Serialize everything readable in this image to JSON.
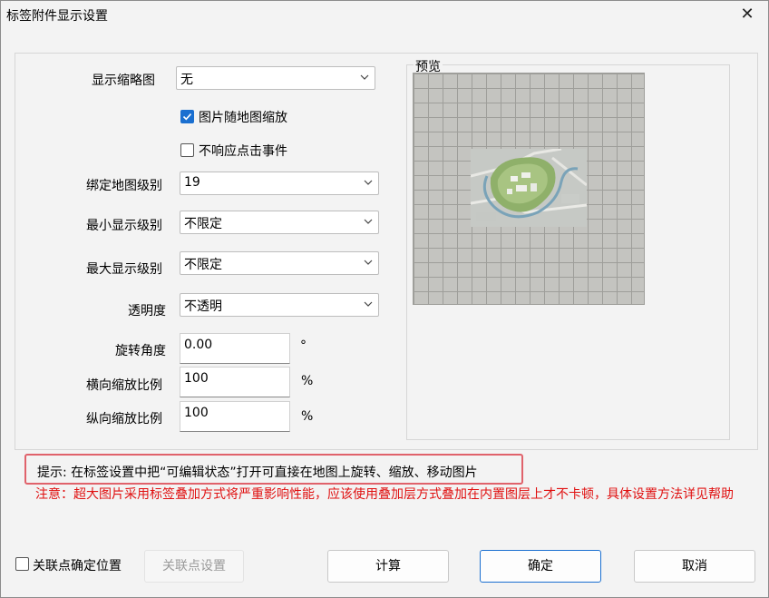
{
  "window": {
    "title": "标签附件显示设置",
    "close_glyph": "✕"
  },
  "form": {
    "thumbnail_label": "显示缩略图",
    "thumbnail_value": "无",
    "scale_with_map_label": "图片随地图缩放",
    "scale_with_map_checked": true,
    "ignore_click_label": "不响应点击事件",
    "ignore_click_checked": false,
    "bind_level_label": "绑定地图级别",
    "bind_level_value": "19",
    "min_level_label": "最小显示级别",
    "min_level_value": "不限定",
    "max_level_label": "最大显示级别",
    "max_level_value": "不限定",
    "opacity_label": "透明度",
    "opacity_value": "不透明",
    "rotation_label": "旋转角度",
    "rotation_value": "0.00",
    "rotation_unit": "°",
    "hscale_label": "横向缩放比例",
    "hscale_value": "100",
    "hscale_unit": "%",
    "vscale_label": "纵向缩放比例",
    "vscale_value": "100",
    "vscale_unit": "%"
  },
  "preview": {
    "title": "预览"
  },
  "hint": "提示: 在标签设置中把“可编辑状态”打开可直接在地图上旋转、缩放、移动图片",
  "warning": "注意：超大图片采用标签叠加方式将严重影响性能，应该使用叠加层方式叠加在内置图层上才不卡顿，具体设置方法详见帮助",
  "footer": {
    "link_point_label": "关联点确定位置",
    "link_point_checked": false,
    "link_settings_button": "关联点设置",
    "calculate_button": "计算",
    "ok_button": "确定",
    "cancel_button": "取消"
  },
  "colors": {
    "accent": "#1a6fd0",
    "warning": "#e01010",
    "hint_border": "#e0626b"
  }
}
